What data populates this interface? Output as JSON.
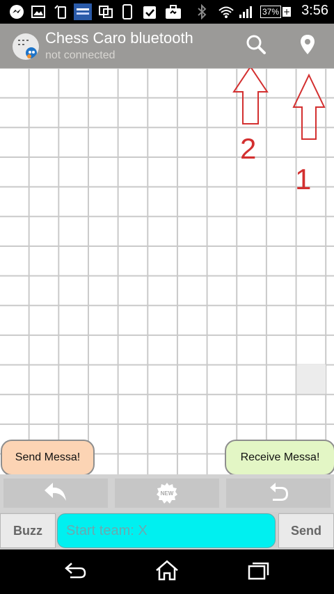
{
  "status_bar": {
    "battery_percent": "37%",
    "time": "3:56",
    "icons": [
      "messenger-icon",
      "image-icon",
      "phone-rotate-icon",
      "app-badge-icon",
      "copy-icon",
      "phone-icon",
      "clipboard-check-icon",
      "briefcase-icon",
      "bluetooth-icon",
      "wifi-icon",
      "signal-icon",
      "battery-icon"
    ]
  },
  "app_bar": {
    "title": "Chess Caro bluetooth",
    "subtitle": "not connected",
    "actions": [
      "search-icon",
      "location-pin-icon"
    ]
  },
  "annotations": {
    "arrow_search_label": "2",
    "arrow_pin_label": "1",
    "color": "#d32f2f"
  },
  "board": {
    "send_label": "Send Messa!",
    "receive_label": "Receive Messa!"
  },
  "toolbar": {
    "new_badge": "NEW"
  },
  "input_row": {
    "buzz_label": "Buzz",
    "input_placeholder": "Start team: X",
    "input_value": "",
    "send_label": "Send"
  },
  "colors": {
    "accent_input": "#00f0f0",
    "send_pill": "#fcd4b4",
    "receive_pill": "#e3f6c5"
  }
}
